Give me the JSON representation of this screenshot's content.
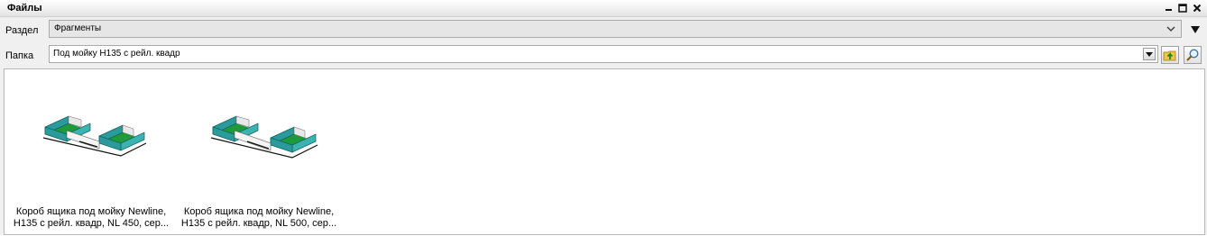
{
  "window": {
    "title": "Файлы",
    "controls": [
      "minimize-icon",
      "maximize-icon",
      "close-icon"
    ]
  },
  "section_row": {
    "label": "Раздел",
    "value": "Фрагменты"
  },
  "folder_row": {
    "label": "Папка",
    "value": "Под мойку H135 с рейл. квадр"
  },
  "files": [
    {
      "line1": "Короб ящика под мойку Newline,",
      "line2": "H135 с рейл. квадр, NL 450, сер..."
    },
    {
      "line1": "Короб ящика под мойку Newline,",
      "line2": "H135 с рейл. квадр, NL 500, сер..."
    }
  ],
  "colors": {
    "teal": "#2a9a9a",
    "green": "#1f9a3a",
    "panel": "#f0f0f0"
  }
}
